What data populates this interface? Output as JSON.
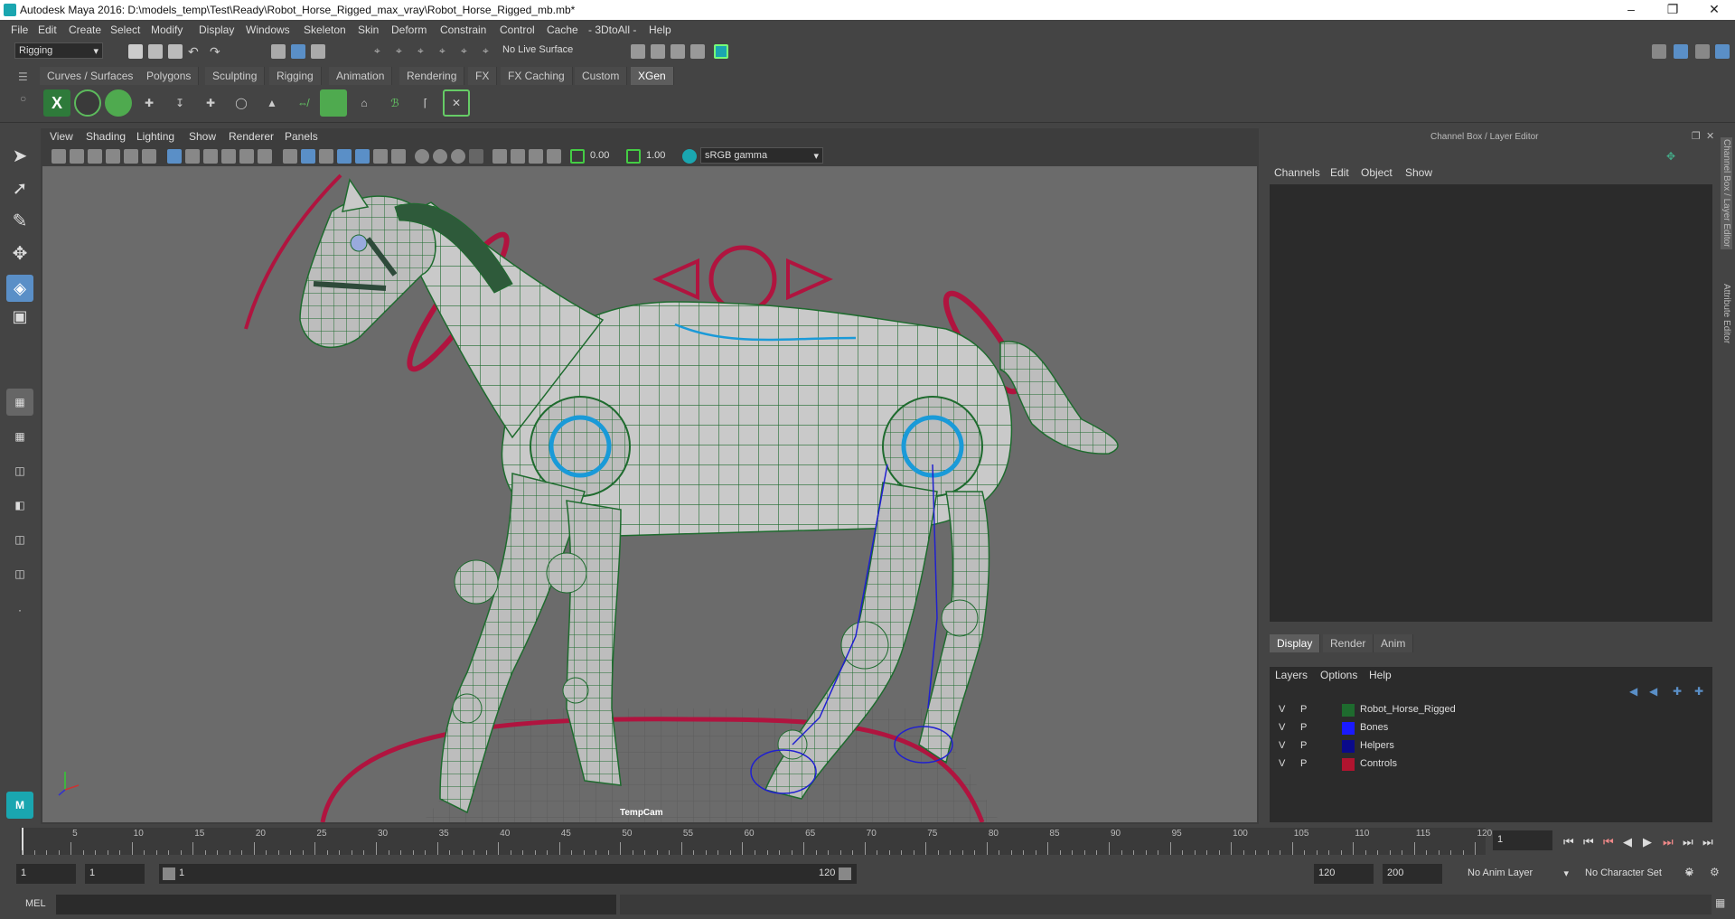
{
  "window": {
    "title": "Autodesk Maya 2016: D:\\models_temp\\Test\\Ready\\Robot_Horse_Rigged_max_vray\\Robot_Horse_Rigged_mb.mb*"
  },
  "menu": [
    "File",
    "Edit",
    "Create",
    "Select",
    "Modify",
    "Display",
    "Windows",
    "Skeleton",
    "Skin",
    "Deform",
    "Constrain",
    "Control",
    "Cache",
    "- 3DtoAll -",
    "Help"
  ],
  "status": {
    "mode": "Rigging",
    "live_surface": "No Live Surface"
  },
  "shelf_tabs": [
    "Curves / Surfaces",
    "Polygons",
    "Sculpting",
    "Rigging",
    "Animation",
    "Rendering",
    "FX",
    "FX Caching",
    "Custom",
    "XGen"
  ],
  "shelf_active": "XGen",
  "viewport": {
    "menu": [
      "View",
      "Shading",
      "Lighting",
      "Show",
      "Renderer",
      "Panels"
    ],
    "exposure": "0.00",
    "gamma": "1.00",
    "colorspace": "sRGB gamma",
    "camera": "TempCam"
  },
  "channel_box": {
    "title": "Channel Box / Layer Editor",
    "menu": [
      "Channels",
      "Edit",
      "Object",
      "Show"
    ]
  },
  "layer_editor": {
    "tabs": [
      "Display",
      "Render",
      "Anim"
    ],
    "menu": [
      "Layers",
      "Options",
      "Help"
    ],
    "layers": [
      {
        "v": "V",
        "p": "P",
        "name": "Robot_Horse_Rigged",
        "color": "#1e6b2e"
      },
      {
        "v": "V",
        "p": "P",
        "name": "Bones",
        "color": "#1a1aff"
      },
      {
        "v": "V",
        "p": "P",
        "name": "Helpers",
        "color": "#0a0a8a"
      },
      {
        "v": "V",
        "p": "P",
        "name": "Controls",
        "color": "#b0142f"
      }
    ]
  },
  "side_tabs": [
    "Channel Box / Layer Editor",
    "Attribute Editor"
  ],
  "timeline": {
    "ticks": [
      "5",
      "10",
      "15",
      "20",
      "25",
      "30",
      "35",
      "40",
      "45",
      "50",
      "55",
      "60",
      "65",
      "70",
      "75",
      "80",
      "85",
      "90",
      "95",
      "100",
      "105",
      "110",
      "115",
      "120"
    ],
    "start_label": "1",
    "current_frame": "1"
  },
  "range": {
    "start": "1",
    "anim_start": "1",
    "range_start": "1",
    "range_end": "120",
    "end": "120",
    "anim_end": "200",
    "anim_layer": "No Anim Layer",
    "char_set": "No Character Set"
  },
  "cmdline": {
    "label": "MEL"
  }
}
